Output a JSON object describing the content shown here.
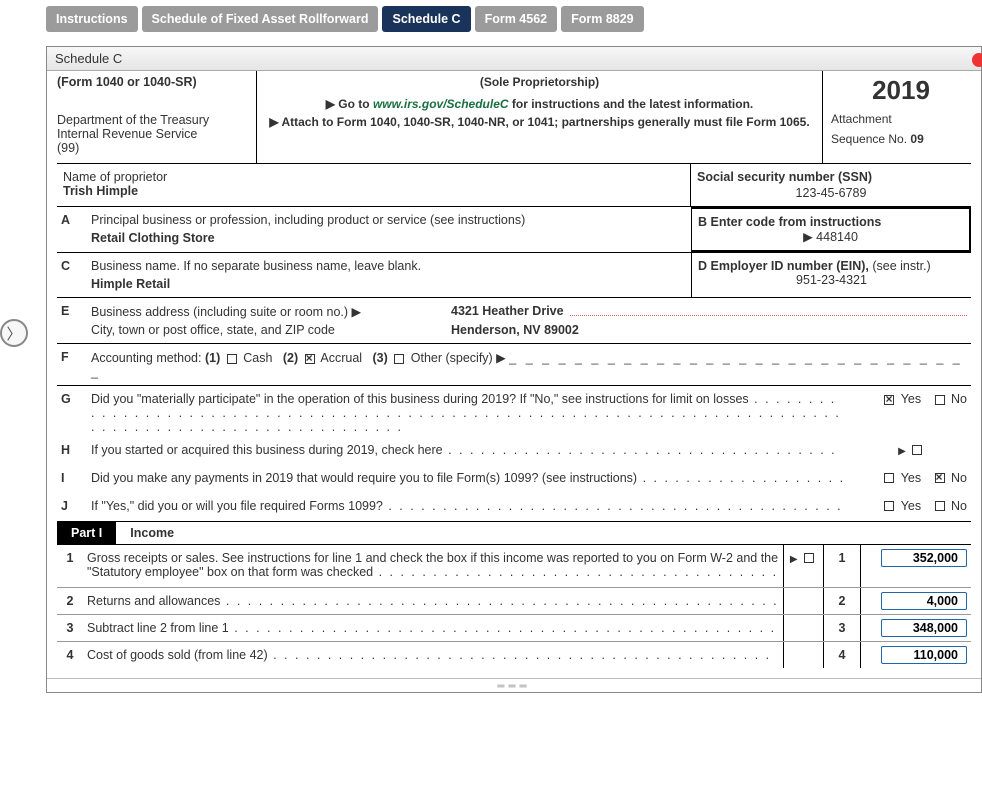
{
  "tabs": {
    "instructions": "Instructions",
    "rollforward": "Schedule of Fixed Asset Rollforward",
    "schedule_c": "Schedule C",
    "form_4562": "Form 4562",
    "form_8829": "Form 8829"
  },
  "window_title": "Schedule C",
  "header": {
    "form_no": "(Form 1040 or 1040-SR)",
    "subtitle": "(Sole Proprietorship)",
    "goto_prefix": "▶ Go to ",
    "goto_link": "www.irs.gov/ScheduleC",
    "goto_suffix": " for instructions and the latest information.",
    "attach": "▶ Attach to Form 1040, 1040-SR, 1040-NR, or 1041; partnerships generally must file Form 1065.",
    "dept1": "Department of the Treasury",
    "dept2": "Internal Revenue Service",
    "dept3": "(99)",
    "year": "2019",
    "attachment": "Attachment",
    "sequence": "Sequence No. ",
    "sequence_no": "09"
  },
  "proprietor": {
    "label": "Name of proprietor",
    "name": "Trish Himple",
    "ssn_label": "Social security number (SSN)",
    "ssn": "123-45-6789"
  },
  "A": {
    "label": "Principal business or profession, including product or service (see instructions)",
    "value": "Retail Clothing Store"
  },
  "B": {
    "label": "B Enter code from instructions",
    "value": "▶ 448140"
  },
  "C": {
    "label": "Business name. If no separate business name, leave blank.",
    "value": "Himple Retail"
  },
  "D": {
    "label": "D Employer ID number (EIN), ",
    "label2": "(see instr.)",
    "value": "951-23-4321"
  },
  "E": {
    "addr_label": "Business address (including suite or room no.) ▶",
    "addr_value": "4321 Heather Drive",
    "city_label": "City, town or post office, state, and ZIP code",
    "city_value": "Henderson, NV 89002"
  },
  "F": {
    "text_pre": "Accounting method:  ",
    "opt1": "(1)",
    "opt1l": "Cash",
    "opt2": "(2)",
    "opt2l": "Accrual",
    "opt3": "(3)",
    "opt3l": "Other (specify) ▶",
    "dashes": "_ _ _ _ _ _ _ _ _ _ _ _ _ _ _ _ _ _ _ _ _ _ _ _ _ _ _ _ _"
  },
  "G": {
    "text": "Did you \"materially participate\" in the operation of this business during 2019? If \"No,\" see instructions for limit on losses",
    "yes": "Yes",
    "no": "No",
    "checked": "yes"
  },
  "H": {
    "text": "If you started or acquired this business during 2019, check here"
  },
  "I": {
    "text": "Did you make any payments in 2019 that would require you to file Form(s) 1099? (see instructions)",
    "checked": "no"
  },
  "J": {
    "text": "If \"Yes,\" did you or will you file required Forms 1099?"
  },
  "yesno": {
    "yes": "Yes",
    "no": "No"
  },
  "part1": {
    "label": "Part I",
    "title": "Income"
  },
  "lines": {
    "l1": {
      "num": "1",
      "desc": "Gross receipts or sales. See instructions for line 1 and check the box if this income was reported to you on Form W-2 and the \"Statutory employee\" box on that form was checked",
      "box": "1",
      "amount": "352,000"
    },
    "l2": {
      "num": "2",
      "desc": "Returns and allowances",
      "box": "2",
      "amount": "4,000"
    },
    "l3": {
      "num": "3",
      "desc": "Subtract line 2 from line 1",
      "box": "3",
      "amount": "348,000"
    },
    "l4": {
      "num": "4",
      "desc": "Cost of goods sold (from line 42)",
      "box": "4",
      "amount": "110,000"
    }
  }
}
